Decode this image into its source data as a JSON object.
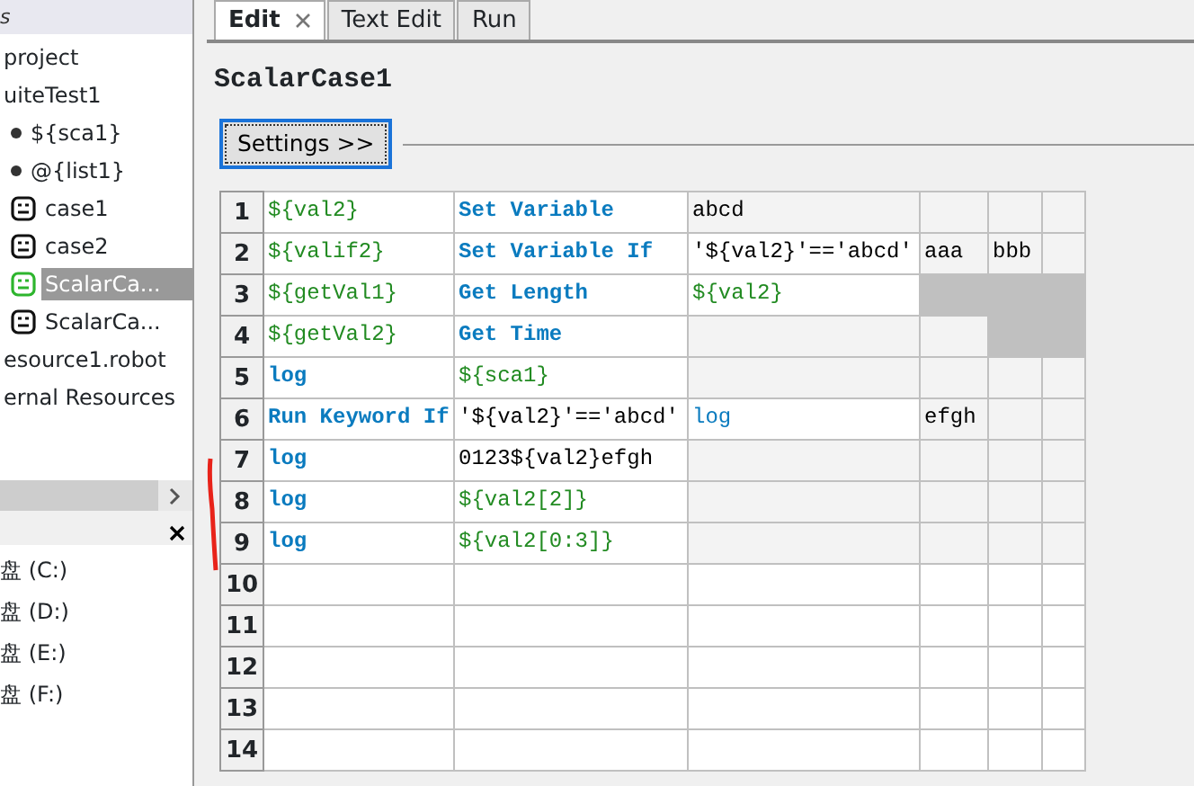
{
  "left_panel": {
    "header": "s",
    "tree": [
      {
        "label": "project",
        "selected": false,
        "children": [
          {
            "label": "uiteTest1",
            "selected": false,
            "children": [
              {
                "label": "${sca1}",
                "kind": "variable",
                "selected": false
              },
              {
                "label": "@{list1}",
                "kind": "variable",
                "selected": false
              },
              {
                "label": "case1",
                "kind": "testcase",
                "selected": false
              },
              {
                "label": "case2",
                "kind": "testcase",
                "selected": false
              },
              {
                "label": "ScalarCa...",
                "kind": "testcase",
                "selected": true
              },
              {
                "label": "ScalarCa...",
                "kind": "testcase",
                "selected": false
              }
            ]
          },
          {
            "label": "esource1.robot",
            "selected": false
          }
        ]
      },
      {
        "label": "ernal Resources",
        "selected": false
      }
    ],
    "drives": [
      "盘 (C:)",
      "盘 (D:)",
      "盘 (E:)",
      "盘 (F:)"
    ]
  },
  "tabs": [
    {
      "label": "Edit",
      "selected": true,
      "closable": true
    },
    {
      "label": "Text Edit",
      "selected": false,
      "closable": false
    },
    {
      "label": "Run",
      "selected": false,
      "closable": false
    }
  ],
  "case_title": "ScalarCase1",
  "settings_button": "Settings >>",
  "grid": {
    "rows": [
      {
        "number": "1",
        "cells": [
          {
            "kind": "variable",
            "active": true,
            "blocked": false,
            "text": "${val2}"
          },
          {
            "kind": "keyword",
            "active": true,
            "blocked": false,
            "text": "Set Variable"
          },
          {
            "kind": "text",
            "active": false,
            "blocked": false,
            "text": "abcd"
          },
          {
            "kind": "text",
            "active": false,
            "blocked": false
          },
          {
            "kind": "text",
            "active": false,
            "blocked": false
          },
          {
            "kind": "text",
            "active": false,
            "blocked": false
          }
        ]
      },
      {
        "number": "2",
        "cells": [
          {
            "kind": "variable",
            "active": true,
            "blocked": false,
            "text": "${valif2}"
          },
          {
            "kind": "keyword",
            "active": true,
            "blocked": false,
            "text": "Set Variable If"
          },
          {
            "kind": "text",
            "active": true,
            "blocked": false,
            "text": "'${val2}'=='abcd'"
          },
          {
            "kind": "text",
            "active": false,
            "blocked": false,
            "text": "aaa"
          },
          {
            "kind": "text",
            "active": false,
            "blocked": false,
            "text": "bbb"
          },
          {
            "kind": "text",
            "active": false,
            "blocked": false
          }
        ]
      },
      {
        "number": "3",
        "cells": [
          {
            "kind": "variable",
            "active": true,
            "blocked": false,
            "text": "${getVal1}"
          },
          {
            "kind": "keyword",
            "active": true,
            "blocked": false,
            "text": "Get Length"
          },
          {
            "kind": "variable",
            "active": true,
            "blocked": false,
            "text": "${val2}"
          },
          {
            "kind": "text",
            "blocked": true
          },
          {
            "kind": "text",
            "blocked": true
          },
          {
            "kind": "text",
            "blocked": true
          }
        ]
      },
      {
        "number": "4",
        "cells": [
          {
            "kind": "variable",
            "active": true,
            "blocked": false,
            "text": "${getVal2}"
          },
          {
            "kind": "keyword",
            "active": true,
            "blocked": false,
            "text": "Get Time"
          },
          {
            "kind": "text",
            "active": false,
            "blocked": false
          },
          {
            "kind": "text",
            "active": false,
            "blocked": false
          },
          {
            "kind": "text",
            "blocked": true
          },
          {
            "kind": "text",
            "blocked": true
          }
        ]
      },
      {
        "number": "5",
        "cells": [
          {
            "kind": "keyword",
            "active": true,
            "blocked": false,
            "text": "log"
          },
          {
            "kind": "variable",
            "active": true,
            "blocked": false,
            "text": "${sca1}"
          },
          {
            "kind": "text",
            "active": false,
            "blocked": false
          },
          {
            "kind": "text",
            "active": false,
            "blocked": false
          },
          {
            "kind": "text",
            "active": false,
            "blocked": false
          },
          {
            "kind": "text",
            "active": false,
            "blocked": false
          }
        ]
      },
      {
        "number": "6",
        "cells": [
          {
            "kind": "keyword",
            "active": true,
            "blocked": false,
            "text": "Run Keyword If"
          },
          {
            "kind": "text",
            "active": true,
            "blocked": false,
            "text": "'${val2}'=='abcd'"
          },
          {
            "kind": "call",
            "active": true,
            "blocked": false,
            "text": "log"
          },
          {
            "kind": "text",
            "active": false,
            "blocked": false,
            "text": "efgh"
          },
          {
            "kind": "text",
            "active": false,
            "blocked": false
          },
          {
            "kind": "text",
            "active": false,
            "blocked": false
          }
        ]
      },
      {
        "number": "7",
        "cells": [
          {
            "kind": "keyword",
            "active": true,
            "blocked": false,
            "text": "log"
          },
          {
            "kind": "text",
            "active": true,
            "blocked": false,
            "text": "0123${val2}efgh"
          },
          {
            "kind": "text",
            "active": false,
            "blocked": false
          },
          {
            "kind": "text",
            "active": false,
            "blocked": false
          },
          {
            "kind": "text",
            "active": false,
            "blocked": false
          },
          {
            "kind": "text",
            "active": false,
            "blocked": false
          }
        ]
      },
      {
        "number": "8",
        "cells": [
          {
            "kind": "keyword",
            "active": true,
            "blocked": false,
            "text": "log"
          },
          {
            "kind": "variable",
            "active": true,
            "blocked": false,
            "text": "${val2[2]}"
          },
          {
            "kind": "text",
            "active": false,
            "blocked": false
          },
          {
            "kind": "text",
            "active": false,
            "blocked": false
          },
          {
            "kind": "text",
            "active": false,
            "blocked": false
          },
          {
            "kind": "text",
            "active": false,
            "blocked": false
          }
        ]
      },
      {
        "number": "9",
        "cells": [
          {
            "kind": "keyword",
            "active": true,
            "blocked": false,
            "text": "log"
          },
          {
            "kind": "variable",
            "active": true,
            "blocked": false,
            "text": "${val2[0:3]}"
          },
          {
            "kind": "text",
            "active": false,
            "blocked": false
          },
          {
            "kind": "text",
            "active": false,
            "blocked": false
          },
          {
            "kind": "text",
            "active": false,
            "blocked": false
          },
          {
            "kind": "text",
            "active": false,
            "blocked": false
          }
        ]
      },
      {
        "number": "10",
        "cells": [
          {
            "active": true,
            "blocked": false
          },
          {
            "active": true,
            "blocked": false
          },
          {
            "active": true,
            "blocked": false
          },
          {
            "active": true,
            "blocked": false
          },
          {
            "active": true,
            "blocked": false
          },
          {
            "active": true,
            "blocked": false
          }
        ]
      },
      {
        "number": "11",
        "cells": [
          {
            "active": true,
            "blocked": false
          },
          {
            "active": true,
            "blocked": false
          },
          {
            "active": true,
            "blocked": false
          },
          {
            "active": true,
            "blocked": false
          },
          {
            "active": true,
            "blocked": false
          },
          {
            "active": true,
            "blocked": false
          }
        ]
      },
      {
        "number": "12",
        "cells": [
          {
            "active": true,
            "blocked": false
          },
          {
            "active": true,
            "blocked": false
          },
          {
            "active": true,
            "blocked": false
          },
          {
            "active": true,
            "blocked": false
          },
          {
            "active": true,
            "blocked": false
          },
          {
            "active": true,
            "blocked": false
          }
        ]
      },
      {
        "number": "13",
        "cells": [
          {
            "active": true,
            "blocked": false
          },
          {
            "active": true,
            "blocked": false
          },
          {
            "active": true,
            "blocked": false
          },
          {
            "active": true,
            "blocked": false
          },
          {
            "active": true,
            "blocked": false
          },
          {
            "active": true,
            "blocked": false
          }
        ]
      },
      {
        "number": "14",
        "cells": [
          {
            "active": true,
            "blocked": false
          },
          {
            "active": true,
            "blocked": false
          },
          {
            "active": true,
            "blocked": false
          },
          {
            "active": true,
            "blocked": false
          },
          {
            "active": true,
            "blocked": false
          },
          {
            "active": true,
            "blocked": false
          }
        ]
      }
    ]
  }
}
